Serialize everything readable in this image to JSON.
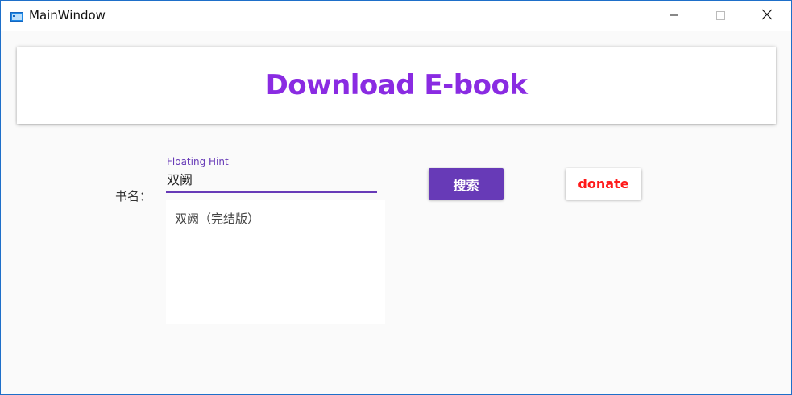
{
  "window": {
    "title": "MainWindow",
    "icon": "app-window-icon",
    "controls": {
      "minimize": "minimize-icon",
      "maximize": "maximize-icon",
      "close": "close-icon"
    }
  },
  "header": {
    "title": "Download E-book",
    "color": "#8a2be2"
  },
  "search": {
    "label": "书名：",
    "hint": "Floating Hint",
    "value": "双阙",
    "accent": "#673ab7",
    "suggestions": [
      "双阙（完结版）"
    ]
  },
  "buttons": {
    "search_label": "搜索",
    "donate_label": "donate",
    "donate_color": "#ff1a1a"
  }
}
